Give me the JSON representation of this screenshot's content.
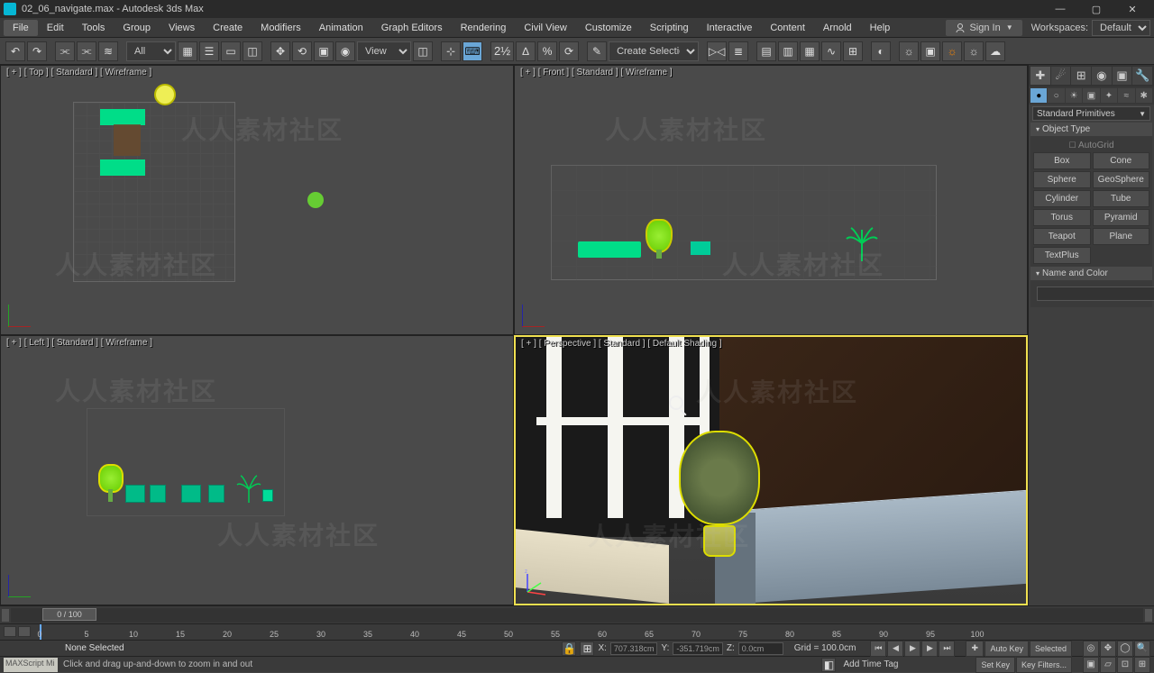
{
  "title": "02_06_navigate.max - Autodesk 3ds Max",
  "window": {
    "min": "—",
    "max": "▢",
    "close": "✕"
  },
  "menus": [
    "File",
    "Edit",
    "Tools",
    "Group",
    "Views",
    "Create",
    "Modifiers",
    "Animation",
    "Graph Editors",
    "Rendering",
    "Civil View",
    "Customize",
    "Scripting",
    "Interactive",
    "Content",
    "Arnold",
    "Help"
  ],
  "signin": "Sign In",
  "workspace": {
    "label": "Workspaces:",
    "value": "Default"
  },
  "toolbar": {
    "drop_all": "All",
    "drop_view": "View",
    "drop_selset": "Create Selection Se"
  },
  "viewports": {
    "top": "[ + ] [ Top ] [ Standard ] [ Wireframe ]",
    "front": "[ + ] [ Front ] [ Standard ] [ Wireframe ]",
    "left": "[ + ] [ Left ] [ Standard ] [ Wireframe ]",
    "persp": "[ + ] [ Perspective ] [ Standard ] [ Default Shading ]"
  },
  "cmdpanel": {
    "dropdown": "Standard Primitives",
    "rollout_obj": "Object Type",
    "autogrid": "AutoGrid",
    "buttons": [
      "Box",
      "Cone",
      "Sphere",
      "GeoSphere",
      "Cylinder",
      "Tube",
      "Torus",
      "Pyramid",
      "Teapot",
      "Plane",
      "TextPlus",
      ""
    ],
    "rollout_name": "Name and Color"
  },
  "timeline": {
    "thumb": "0 / 100",
    "ticks": [
      "0",
      "5",
      "10",
      "15",
      "20",
      "25",
      "30",
      "35",
      "40",
      "45",
      "50",
      "55",
      "60",
      "65",
      "70",
      "75",
      "80",
      "85",
      "90",
      "95",
      "100"
    ]
  },
  "status": {
    "mxs": "MAXScript Mi",
    "selection": "None Selected",
    "hint": "Click and drag up-and-down to zoom in and out",
    "x_label": "X:",
    "x": "707.318cm",
    "y_label": "Y:",
    "y": "-351.719cm",
    "z_label": "Z:",
    "z": "0.0cm",
    "grid": "Grid = 100.0cm",
    "addtag": "Add Time Tag",
    "autokey": "Auto Key",
    "setkey": "Set Key",
    "selected": "Selected",
    "keyfilters": "Key Filters..."
  }
}
